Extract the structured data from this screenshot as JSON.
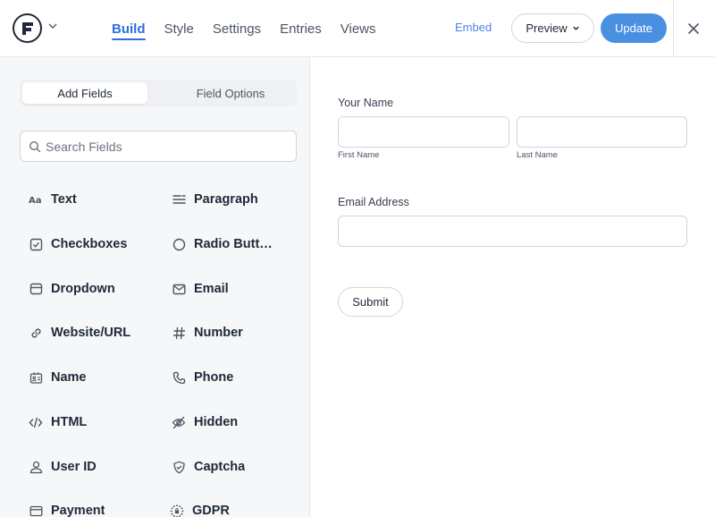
{
  "header": {
    "nav": [
      {
        "label": "Build",
        "active": true
      },
      {
        "label": "Style",
        "active": false
      },
      {
        "label": "Settings",
        "active": false
      },
      {
        "label": "Entries",
        "active": false
      },
      {
        "label": "Views",
        "active": false
      }
    ],
    "embed_label": "Embed",
    "preview_label": "Preview",
    "update_label": "Update"
  },
  "sidebar": {
    "tabs": [
      {
        "label": "Add Fields",
        "active": true
      },
      {
        "label": "Field Options",
        "active": false
      }
    ],
    "search_placeholder": "Search Fields",
    "fields": [
      {
        "label": "Text",
        "icon": "text-icon"
      },
      {
        "label": "Paragraph",
        "icon": "paragraph-icon"
      },
      {
        "label": "Checkboxes",
        "icon": "checkbox-icon"
      },
      {
        "label": "Radio Buttons",
        "icon": "radio-icon"
      },
      {
        "label": "Dropdown",
        "icon": "dropdown-icon"
      },
      {
        "label": "Email",
        "icon": "email-icon"
      },
      {
        "label": "Website/URL",
        "icon": "link-icon"
      },
      {
        "label": "Number",
        "icon": "hash-icon"
      },
      {
        "label": "Name",
        "icon": "id-card-icon"
      },
      {
        "label": "Phone",
        "icon": "phone-icon"
      },
      {
        "label": "HTML",
        "icon": "code-icon"
      },
      {
        "label": "Hidden",
        "icon": "eye-off-icon"
      },
      {
        "label": "User ID",
        "icon": "user-icon"
      },
      {
        "label": "Captcha",
        "icon": "shield-check-icon"
      },
      {
        "label": "Payment",
        "icon": "credit-card-icon"
      },
      {
        "label": "GDPR",
        "icon": "gdpr-stars-icon"
      }
    ]
  },
  "form": {
    "name_label": "Your Name",
    "first_name_sublabel": "First Name",
    "last_name_sublabel": "Last Name",
    "email_label": "Email Address",
    "submit_label": "Submit"
  },
  "colors": {
    "accent": "#2f6fdb",
    "update_button": "#4a90e2",
    "sidebar_bg": "#f6f7f9"
  }
}
